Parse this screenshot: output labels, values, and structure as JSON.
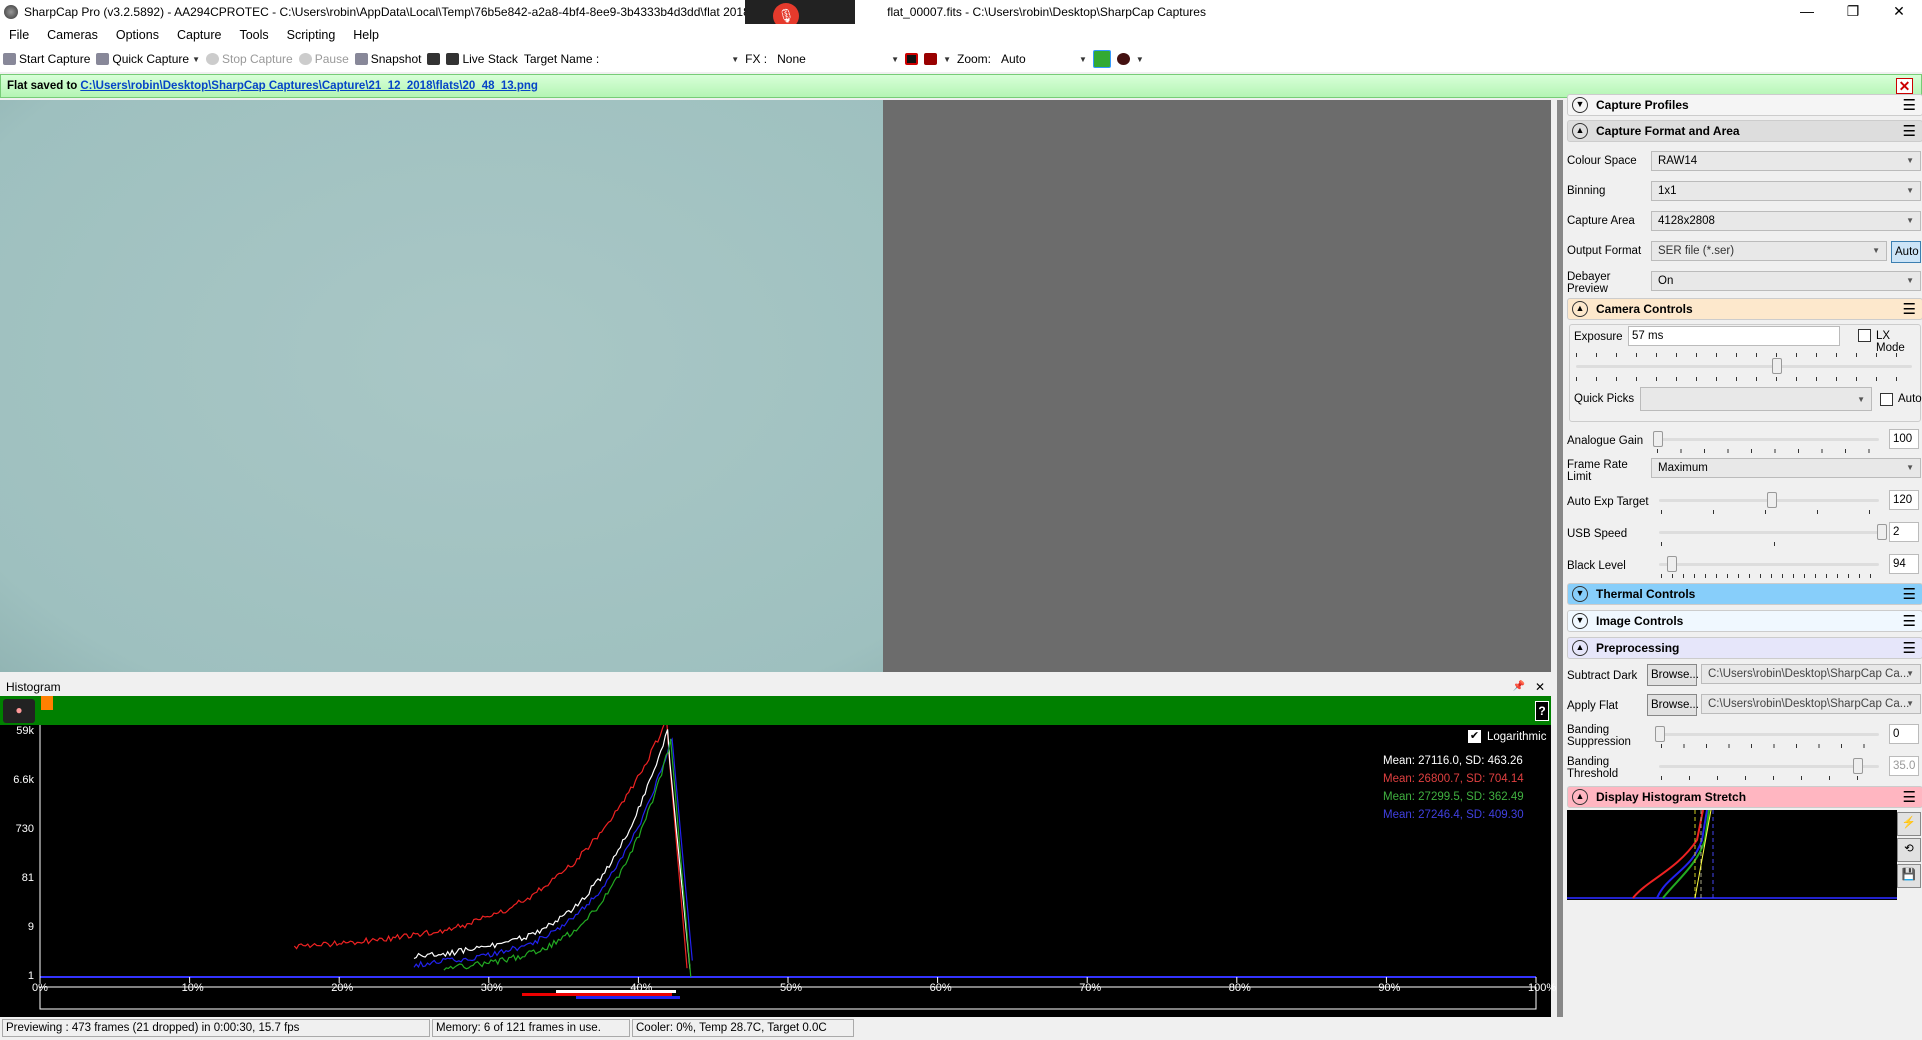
{
  "window": {
    "title": "SharpCap Pro (v3.2.5892) - AA294CPROTEC - C:\\Users\\robin\\AppData\\Local\\Temp\\76b5e842-a2a8-4bf4-8ee9-3b4333b4d3dd\\flat 2018-12",
    "title_tail": "flat_00007.fits - C:\\Users\\robin\\Desktop\\SharpCap Captures",
    "minimize": "—",
    "restore": "❐",
    "close": "✕"
  },
  "menu": [
    "File",
    "Cameras",
    "Options",
    "Capture",
    "Tools",
    "Scripting",
    "Help"
  ],
  "toolbar": {
    "start_capture": "Start Capture",
    "quick_capture": "Quick Capture",
    "stop_capture": "Stop Capture",
    "pause": "Pause",
    "snapshot": "Snapshot",
    "live_stack": "Live Stack",
    "target_name_label": "Target Name :",
    "target_name_value": "",
    "fx_label": "FX :",
    "fx_value": "None",
    "zoom_label": "Zoom:",
    "zoom_value": "Auto"
  },
  "notice": {
    "text": "Flat saved to",
    "link": "C:\\Users\\robin\\Desktop\\SharpCap Captures\\Capture\\21_12_2018\\flats\\20_48_13.png",
    "close": "✕"
  },
  "histogram": {
    "title": "Histogram",
    "pin": "📌",
    "close": "✕",
    "help": "?",
    "logarithmic_label": "Logarithmic",
    "logarithmic": true,
    "y_ticks": [
      "59k",
      "6.6k",
      "730",
      "81",
      "9",
      "1"
    ],
    "x_ticks": [
      "0%",
      "10%",
      "20%",
      "30%",
      "40%",
      "50%",
      "60%",
      "70%",
      "80%",
      "90%",
      "100%"
    ],
    "stats": [
      {
        "text": "Mean: 27116.0, SD: 463.26",
        "color": "#ffffff"
      },
      {
        "text": "Mean: 26800.7, SD: 704.14",
        "color": "#e04040"
      },
      {
        "text": "Mean: 27299.5, SD: 362.49",
        "color": "#40b040"
      },
      {
        "text": "Mean: 27246.4, SD: 409.30",
        "color": "#4040e0"
      }
    ]
  },
  "panel": {
    "capture_profiles": "Capture Profiles",
    "capture_format": {
      "title": "Capture Format and Area",
      "colour_space_label": "Colour Space",
      "colour_space": "RAW14",
      "binning_label": "Binning",
      "binning": "1x1",
      "capture_area_label": "Capture Area",
      "capture_area": "4128x2808",
      "output_format_label": "Output Format",
      "output_format": "SER file (*.ser)",
      "auto": "Auto",
      "debayer_label": "Debayer Preview",
      "debayer": "On"
    },
    "camera_controls": {
      "title": "Camera Controls",
      "exposure_label": "Exposure",
      "exposure": "57 ms",
      "lx_mode": "LX Mode",
      "quick_picks_label": "Quick Picks",
      "quick_picks": "",
      "auto": "Auto",
      "gain_label": "Analogue Gain",
      "gain": "100",
      "frame_rate_label": "Frame Rate Limit",
      "frame_rate": "Maximum",
      "auto_exp_label": "Auto Exp Target",
      "auto_exp": "120",
      "usb_label": "USB Speed",
      "usb": "2",
      "black_label": "Black Level",
      "black": "94"
    },
    "thermal": "Thermal Controls",
    "image_controls": "Image Controls",
    "preprocessing": {
      "title": "Preprocessing",
      "dark_label": "Subtract Dark",
      "browse": "Browse...",
      "dark_path": "C:\\Users\\robin\\Desktop\\SharpCap Ca...",
      "flat_label": "Apply Flat",
      "flat_path": "C:\\Users\\robin\\Desktop\\SharpCap Ca...",
      "banding_supp_label": "Banding Suppression",
      "banding_supp": "0",
      "banding_thr_label": "Banding Threshold",
      "banding_thr": "35.0"
    },
    "stretch": "Display Histogram Stretch"
  },
  "status": {
    "preview": "Previewing : 473 frames (21 dropped) in 0:00:30, 15.7 fps",
    "memory": "Memory: 6 of 121 frames in use.",
    "cooler": "Cooler: 0%, Temp 28.7C, Target 0.0C"
  },
  "colors": {
    "notice_bg": "#c4f8c4",
    "histogram_bar": "#008000",
    "thermal": "#87cefa",
    "camera": "#fde8cc",
    "preprocessing": "#e6e6fa",
    "stretch": "#ffb6c1"
  }
}
